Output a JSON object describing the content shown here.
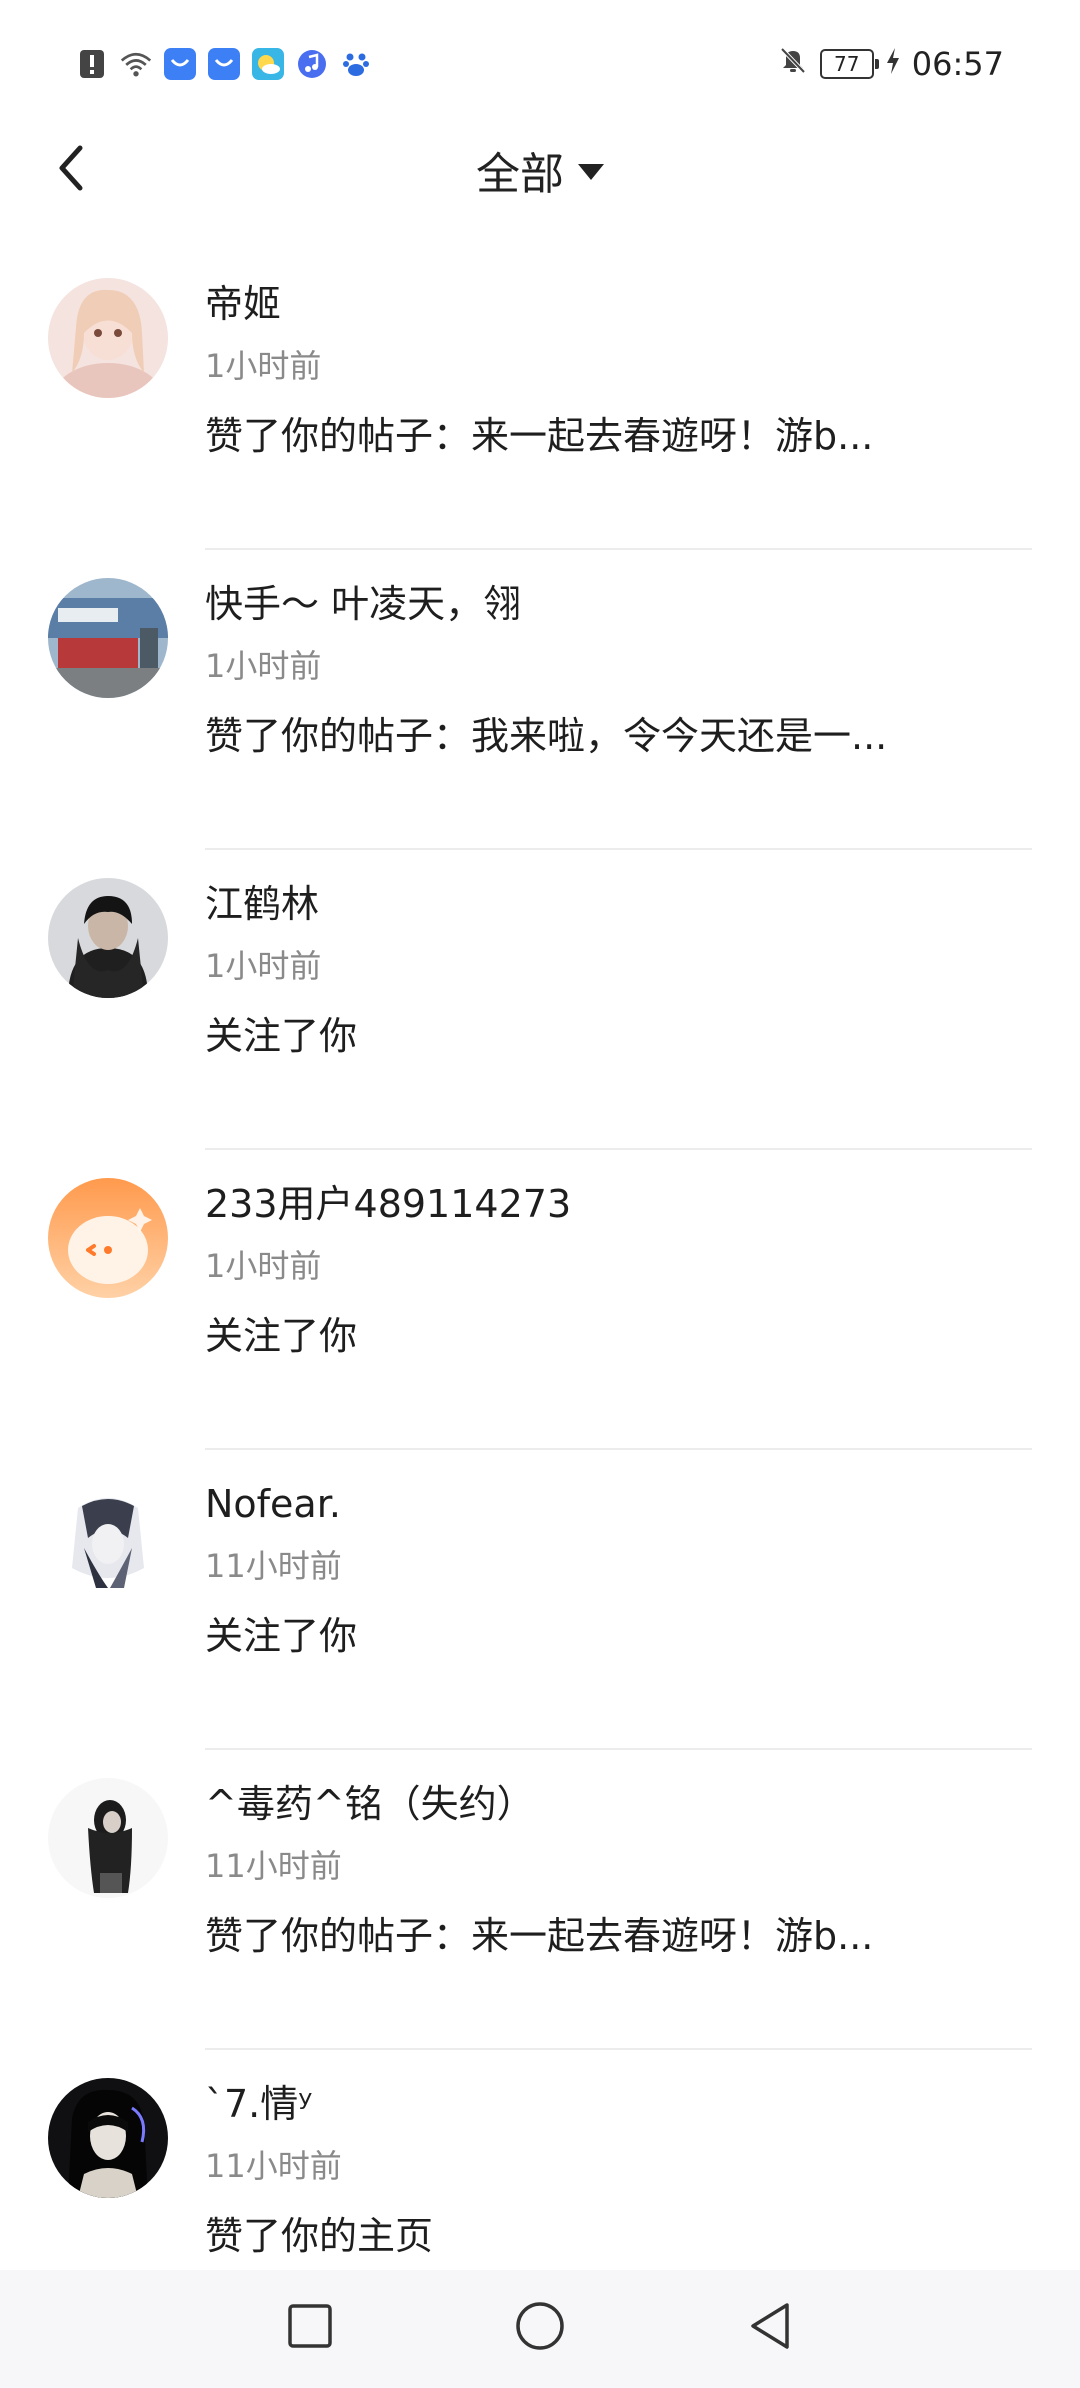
{
  "status_bar": {
    "time": "06:57",
    "battery": "77",
    "left_icons": [
      "alert-icon",
      "wifi-icon",
      "taobao-icon",
      "taobao-icon-2",
      "weather-icon",
      "music-icon",
      "baidu-icon"
    ],
    "right_icons": [
      "mute-bell-icon",
      "charging-icon"
    ]
  },
  "header": {
    "title": "全部",
    "back_icon": "chevron-left-icon",
    "dropdown_icon": "caret-down-icon"
  },
  "notifications": [
    {
      "name": "帝姬",
      "time": "1小时前",
      "message": "赞了你的帖子：来一起去春遊呀！游b...",
      "avatar_color": "#e8c4bd"
    },
    {
      "name": "快手～ 叶凌天，翎",
      "time": "1小时前",
      "message": "赞了你的帖子：我来啦，令今天还是一...",
      "avatar_color": "#6f8fb0"
    },
    {
      "name": "江鹤林",
      "time": "1小时前",
      "message": "关注了你",
      "avatar_color": "#2c2c2c"
    },
    {
      "name": "233用户489114273",
      "time": "1小时前",
      "message": "关注了你",
      "avatar_color": "#ffa35a"
    },
    {
      "name": "Nofear.",
      "time": "11小时前",
      "message": "关注了你",
      "avatar_color": "#cfd3de"
    },
    {
      "name": "^毒药^铭（失约）",
      "time": "11小时前",
      "message": "赞了你的帖子：来一起去春遊呀！游b...",
      "avatar_color": "#f2f2f2"
    },
    {
      "name": "`7.情ʸ",
      "time": "11小时前",
      "message": "赞了你的主页",
      "avatar_color": "#1a1a1a"
    }
  ],
  "nav_bar": {
    "icons": [
      "recent-apps-icon",
      "home-icon",
      "back-icon"
    ]
  }
}
